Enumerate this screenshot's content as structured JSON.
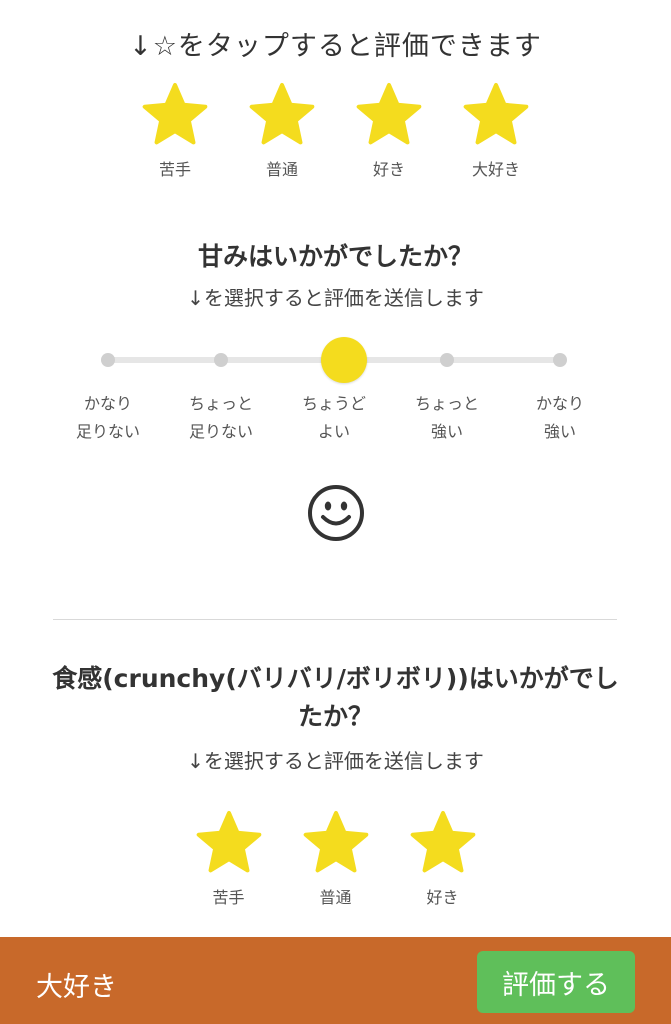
{
  "colors": {
    "star": "#f4dc1e",
    "slider_thumb": "#f4dc1e",
    "bottom_bar": "#c8692a",
    "submit_button": "#5fbf5a"
  },
  "overall": {
    "hint": "↓☆をタップすると評価できます",
    "stars": [
      {
        "label": "苦手",
        "icon": "star-icon"
      },
      {
        "label": "普通",
        "icon": "star-icon"
      },
      {
        "label": "好き",
        "icon": "star-icon"
      },
      {
        "label": "大好き",
        "icon": "star-icon"
      }
    ]
  },
  "sweetness": {
    "title": "甘みはいかがでしたか？",
    "subtitle": "↓を選択すると評価を送信します",
    "options": [
      "かなり\n足りない",
      "ちょっと\n足りない",
      "ちょうど\nよい",
      "ちょっと\n強い",
      "かなり\n強い"
    ],
    "selected_index": 2,
    "feedback_icon": "smiley-face-icon"
  },
  "texture": {
    "title": "食感(crunchy(バリバリ/ボリボリ))はいかがでしたか？",
    "subtitle": "↓を選択すると評価を送信します",
    "stars": [
      {
        "label": "苦手",
        "icon": "star-icon"
      },
      {
        "label": "普通",
        "icon": "star-icon"
      },
      {
        "label": "好き",
        "icon": "star-icon"
      }
    ]
  },
  "bottom_bar": {
    "current_rating": "大好き",
    "submit_label": "評価する"
  }
}
